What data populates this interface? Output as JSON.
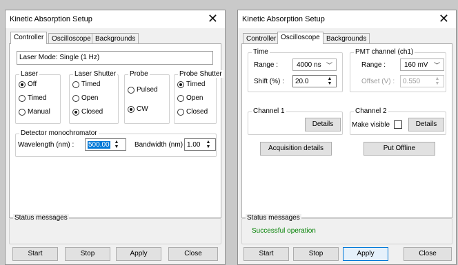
{
  "left": {
    "title": "Kinetic Absorption Setup",
    "tabs": [
      "Controller",
      "Oscilloscope",
      "Backgrounds"
    ],
    "laser_mode": "Laser Mode: Single (1 Hz)",
    "laser": {
      "label": "Laser",
      "options": [
        "Off",
        "Timed",
        "Manual"
      ],
      "selected": "Off"
    },
    "laser_shutter": {
      "label": "Laser Shutter",
      "options": [
        "Timed",
        "Open",
        "Closed"
      ],
      "selected": "Closed"
    },
    "probe": {
      "label": "Probe",
      "options": [
        "Pulsed",
        "CW"
      ],
      "selected": "CW"
    },
    "probe_shutter": {
      "label": "Probe Shutter",
      "options": [
        "Timed",
        "Open",
        "Closed"
      ],
      "selected": "Timed"
    },
    "detector": {
      "label": "Detector monochromator",
      "wavelength_label": "Wavelength (nm) :",
      "wavelength_value": "500.00",
      "bandwidth_label": "Bandwidth (nm) :",
      "bandwidth_value": "1.00"
    },
    "status": {
      "label": "Status messages",
      "message": ""
    },
    "buttons": {
      "start": "Start",
      "stop": "Stop",
      "apply": "Apply",
      "close": "Close"
    }
  },
  "right": {
    "title": "Kinetic Absorption Setup",
    "tabs": [
      "Controller",
      "Oscilloscope",
      "Backgrounds"
    ],
    "time": {
      "label": "Time",
      "range_label": "Range :",
      "range_value": "4000 ns",
      "shift_label": "Shift (%) :",
      "shift_value": "20.0"
    },
    "pmt": {
      "label": "PMT channel (ch1)",
      "range_label": "Range :",
      "range_value": "160 mV",
      "offset_label": "Offset (V) :",
      "offset_value": "0.550"
    },
    "channel1": {
      "label": "Channel 1",
      "details": "Details"
    },
    "channel2": {
      "label": "Channel 2",
      "make_visible": "Make visible",
      "details": "Details"
    },
    "acquisition_details": "Acquisition details",
    "put_offline": "Put Offline",
    "status": {
      "label": "Status messages",
      "message": "Successful operation"
    },
    "buttons": {
      "start": "Start",
      "stop": "Stop",
      "apply": "Apply",
      "close": "Close"
    }
  },
  "icons": {
    "close": "close-icon",
    "radio_on": "radio-selected",
    "radio_off": "radio-unselected"
  },
  "colors": {
    "status_success": "#008000",
    "selection": "#0078d7"
  }
}
